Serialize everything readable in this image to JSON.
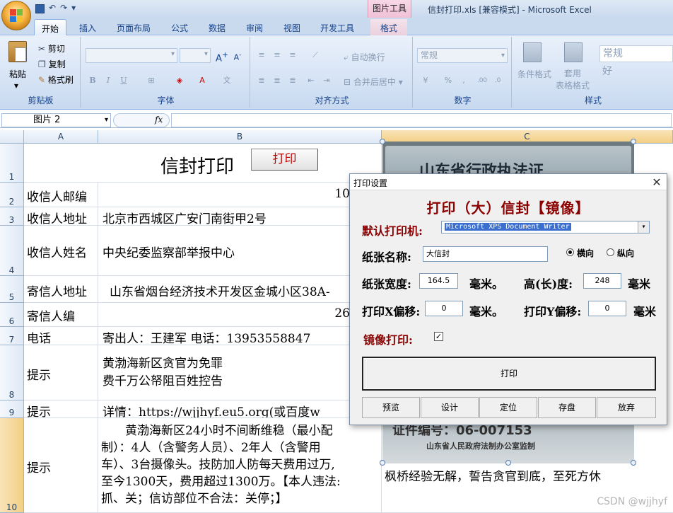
{
  "window": {
    "title": "信封打印.xls  [兼容模式] - Microsoft Excel",
    "context_tab_group": "图片工具"
  },
  "ribbon_tabs": [
    "开始",
    "插入",
    "页面布局",
    "公式",
    "数据",
    "审阅",
    "视图",
    "开发工具",
    "格式"
  ],
  "ribbon": {
    "clipboard": {
      "paste": "粘贴",
      "cut": "剪切",
      "copy": "复制",
      "format_painter": "格式刷",
      "label": "剪贴板"
    },
    "font": {
      "label": "字体",
      "bold": "B",
      "italic": "I",
      "underline": "U",
      "grow": "A",
      "shrink": "A"
    },
    "alignment": {
      "label": "对齐方式",
      "wrap": "自动换行",
      "merge": "合并后居中"
    },
    "number": {
      "label": "数字",
      "format": "常规",
      "percent": "%",
      "comma": ","
    },
    "styles": {
      "label": "样式",
      "conditional": "条件格式",
      "table": "套用\n表格格式",
      "normal": "常规",
      "good": "好"
    }
  },
  "formula_bar": {
    "name_box": "图片 2",
    "fx": "fx"
  },
  "columns": [
    "A",
    "B",
    "C"
  ],
  "sheet": {
    "title": "信封打印",
    "print_button": "打印",
    "rows": [
      {
        "num": "1"
      },
      {
        "num": "2",
        "a": "收信人邮编",
        "b": "10"
      },
      {
        "num": "3",
        "a": "收信人地址",
        "b": "北京市西城区广安门南街甲2号"
      },
      {
        "num": "4",
        "a": "收信人姓名",
        "b": "中央纪委监察部举报中心"
      },
      {
        "num": "5",
        "a": "寄信人地址",
        "b": "山东省烟台经济技术开发区金城小区38A-"
      },
      {
        "num": "6",
        "a": "寄信人编",
        "b": "26"
      },
      {
        "num": "7",
        "a": "电话",
        "b": "寄出人：王建军   电话：13953558847"
      },
      {
        "num": "8",
        "a": "提示",
        "b1": "黄渤海新区贪官为免罪",
        "b2": "费千万公帑阻百姓控告"
      },
      {
        "num": "9",
        "a": "提示",
        "b": "详情：https://wjjhyf.eu5.org(或百度w"
      },
      {
        "num": "10",
        "a": "提示",
        "b1": "　　黄渤海新区24小时不间断维稳（最小配",
        "b2": "制）：4人（含警务人员）、2年人（含警用",
        "b3": "车）、3台摄像头。技防加人防每天费用过万,",
        "b4": "至今1300天，费用超过1300万。【本人违法:",
        "b5": "抓、关；信访部位不合法：关停；】"
      }
    ],
    "c10": "枫桥经验无解，誓告贪官到底，至死方休"
  },
  "picture": {
    "top_text": "山东省行政执法证",
    "cert_label": "证件编号：06-007153",
    "issuer": "山东省人民政府法制办公室监制"
  },
  "dialog": {
    "title": "打印设置",
    "heading": "打印（大）信封【镜像】",
    "printer_label": "默认打印机:",
    "printer_value": "Microsoft XPS Document Writer",
    "paper_label": "纸张名称:",
    "paper_value": "大信封",
    "orient_landscape": "横向",
    "orient_portrait": "纵向",
    "width_label": "纸张宽度:",
    "width_value": "164.5",
    "mm1": "毫米。",
    "height_label": "高(长)度:",
    "height_value": "248",
    "mm2": "毫米",
    "xoff_label": "打印X偏移:",
    "xoff_value": "0",
    "mm3": "毫米。",
    "yoff_label": "打印Y偏移:",
    "yoff_value": "0",
    "mm4": "毫米",
    "mirror_label": "镜像打印:",
    "mirror_checked": "✓",
    "print_btn": "打印",
    "buttons": [
      "预览",
      "设计",
      "定位",
      "存盘",
      "放弃"
    ]
  },
  "watermark": "CSDN @wjjhyf"
}
